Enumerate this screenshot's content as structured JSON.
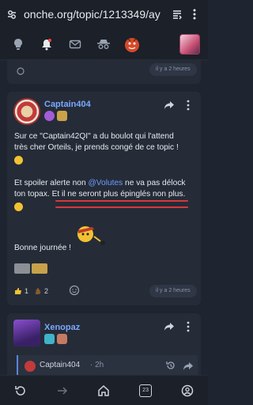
{
  "browser": {
    "url": "onche.org/topic/1213349/ay"
  },
  "previous_post": {
    "time": "il y a 2 heures"
  },
  "post": {
    "author": "Captain404",
    "lines": {
      "l1": "Sur ce \"Captain42QI\" a du boulot qui l'attend",
      "l2": "très cher Orteils, je prends congé de ce topic !",
      "l3a": "Et spoiler alerte non ",
      "mention": "@Volutes",
      "l3b": " ne va pas délock",
      "l4": "ton topax. Et il ne seront plus épinglés non plus.",
      "l5": "Bonne journée !"
    },
    "reactions": [
      {
        "icon": "thumbs-up-icon",
        "count": "1"
      },
      {
        "icon": "poop-icon",
        "count": "2"
      }
    ],
    "time": "il y a 2 heures"
  },
  "next_post": {
    "author": "Xenopaz",
    "quote_author": "Captain404",
    "quote_time": "· 2h"
  },
  "bottom_nav": {
    "tab_count": "23"
  }
}
